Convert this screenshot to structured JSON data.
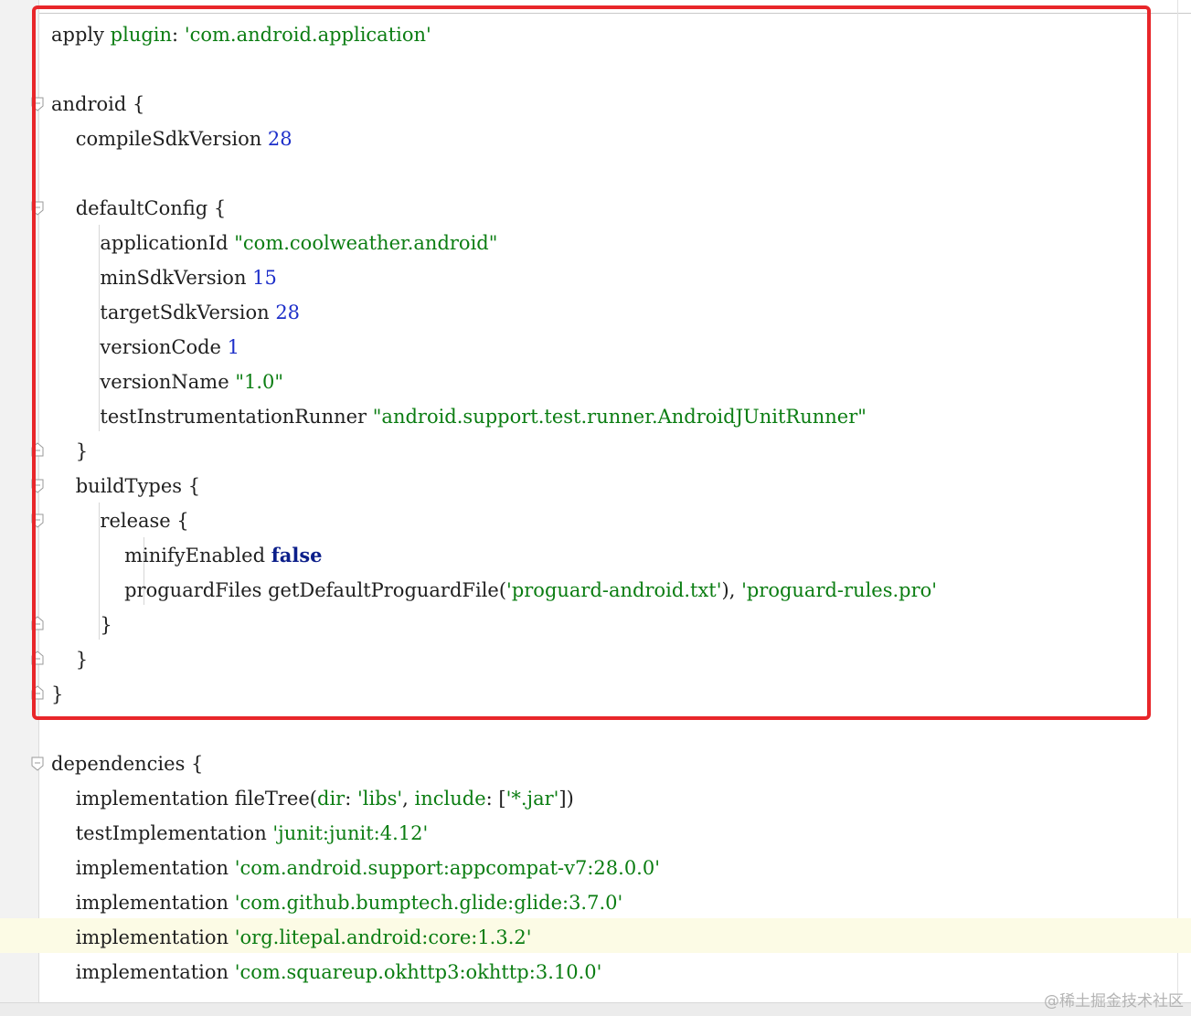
{
  "editor": {
    "lines": [
      {
        "id": "l1",
        "segments": [
          [
            "plain",
            "apply "
          ],
          [
            "param",
            "plugin"
          ],
          [
            "plain",
            ": "
          ],
          [
            "str",
            "'com.android.application'"
          ]
        ]
      },
      {
        "id": "l2",
        "segments": [
          [
            "plain",
            "android {"
          ]
        ]
      },
      {
        "id": "l3",
        "segments": [
          [
            "plain",
            "    compileSdkVersion "
          ],
          [
            "num",
            "28"
          ]
        ]
      },
      {
        "id": "l4",
        "segments": [
          [
            "plain",
            "    defaultConfig {"
          ]
        ]
      },
      {
        "id": "l5",
        "segments": [
          [
            "plain",
            "        applicationId "
          ],
          [
            "str",
            "\"com.coolweather.android\""
          ]
        ]
      },
      {
        "id": "l6",
        "segments": [
          [
            "plain",
            "        minSdkVersion "
          ],
          [
            "num",
            "15"
          ]
        ]
      },
      {
        "id": "l7",
        "segments": [
          [
            "plain",
            "        targetSdkVersion "
          ],
          [
            "num",
            "28"
          ]
        ]
      },
      {
        "id": "l8",
        "segments": [
          [
            "plain",
            "        versionCode "
          ],
          [
            "num",
            "1"
          ]
        ]
      },
      {
        "id": "l9",
        "segments": [
          [
            "plain",
            "        versionName "
          ],
          [
            "str",
            "\"1.0\""
          ]
        ]
      },
      {
        "id": "l10",
        "segments": [
          [
            "plain",
            "        testInstrumentationRunner "
          ],
          [
            "str",
            "\"android.support.test.runner.AndroidJUnitRunner\""
          ]
        ]
      },
      {
        "id": "l11",
        "segments": [
          [
            "plain",
            "    }"
          ]
        ]
      },
      {
        "id": "l12",
        "segments": [
          [
            "plain",
            "    buildTypes {"
          ]
        ]
      },
      {
        "id": "l13",
        "segments": [
          [
            "plain",
            "        release {"
          ]
        ]
      },
      {
        "id": "l14",
        "segments": [
          [
            "plain",
            "            minifyEnabled "
          ],
          [
            "kw",
            "false"
          ]
        ]
      },
      {
        "id": "l15",
        "segments": [
          [
            "plain",
            "            proguardFiles getDefaultProguardFile("
          ],
          [
            "str",
            "'proguard-android.txt'"
          ],
          [
            "plain",
            "), "
          ],
          [
            "str",
            "'proguard-rules.pro'"
          ]
        ]
      },
      {
        "id": "l16",
        "segments": [
          [
            "plain",
            "        }"
          ]
        ]
      },
      {
        "id": "l17",
        "segments": [
          [
            "plain",
            "    }"
          ]
        ]
      },
      {
        "id": "l18",
        "segments": [
          [
            "plain",
            "}"
          ]
        ]
      },
      {
        "id": "l19",
        "segments": [
          [
            "plain",
            "dependencies {"
          ]
        ]
      },
      {
        "id": "l20",
        "segments": [
          [
            "plain",
            "    implementation fileTree("
          ],
          [
            "param",
            "dir"
          ],
          [
            "plain",
            ": "
          ],
          [
            "str",
            "'libs'"
          ],
          [
            "plain",
            ", "
          ],
          [
            "param",
            "include"
          ],
          [
            "plain",
            ": ["
          ],
          [
            "str",
            "'*.jar'"
          ],
          [
            "plain",
            "])"
          ]
        ]
      },
      {
        "id": "l21",
        "segments": [
          [
            "plain",
            "    testImplementation "
          ],
          [
            "str",
            "'junit:junit:4.12'"
          ]
        ]
      },
      {
        "id": "l22",
        "segments": [
          [
            "plain",
            "    implementation "
          ],
          [
            "str",
            "'com.android.support:appcompat-v7:28.0.0'"
          ]
        ]
      },
      {
        "id": "l23",
        "segments": [
          [
            "plain",
            "    implementation "
          ],
          [
            "str",
            "'com.github.bumptech.glide:glide:3.7.0'"
          ]
        ]
      },
      {
        "id": "l24",
        "segments": [
          [
            "plain",
            "    implementation "
          ],
          [
            "str",
            "'org.litepal.android:core:1.3.2'"
          ]
        ]
      },
      {
        "id": "l25",
        "segments": [
          [
            "plain",
            "    implementation "
          ],
          [
            "str",
            "'com.squareup.okhttp3:okhttp:3.10.0'"
          ]
        ]
      }
    ]
  },
  "colors": {
    "plain": "#1f1f1f",
    "string": "#0b7d12",
    "number": "#1d2fc9",
    "keyword": "#0c1f8a",
    "highlight_box": "#e8262a",
    "current_line": "#fcfbe5"
  },
  "watermark": "@稀土掘金技术社区"
}
